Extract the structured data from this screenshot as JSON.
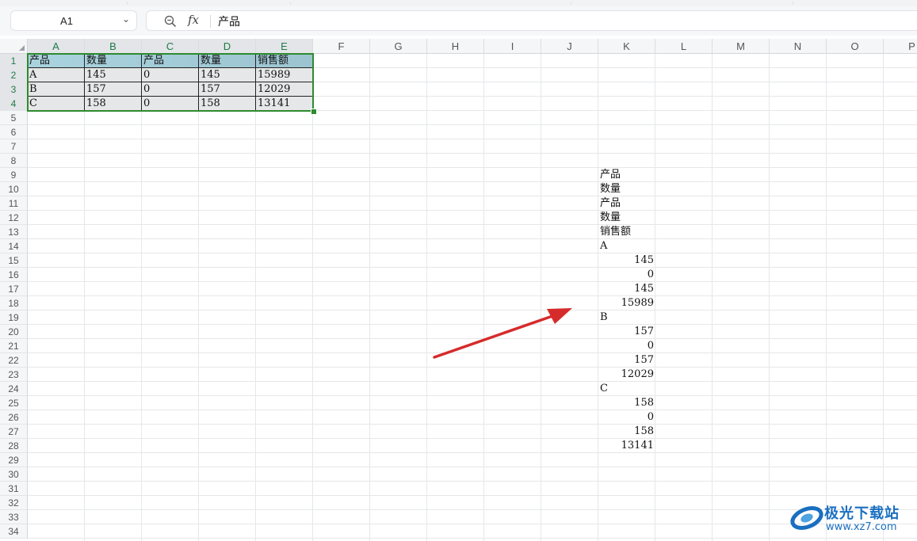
{
  "formula_bar": {
    "name_box": "A1",
    "fx_label": "fx",
    "formula": "产品"
  },
  "columns": [
    "A",
    "B",
    "C",
    "D",
    "E",
    "F",
    "G",
    "H",
    "I",
    "J",
    "K",
    "L",
    "M",
    "N",
    "O",
    "P"
  ],
  "rows": [
    "1",
    "2",
    "3",
    "4",
    "5",
    "6",
    "7",
    "8",
    "9",
    "10",
    "11",
    "12",
    "13",
    "14",
    "15",
    "16",
    "17",
    "18",
    "19",
    "20",
    "21",
    "22",
    "23",
    "24",
    "25",
    "26",
    "27",
    "28",
    "29",
    "30",
    "31",
    "32",
    "33",
    "34"
  ],
  "table": {
    "header": [
      "产品",
      "数量",
      "产品",
      "数量",
      "销售额"
    ],
    "rows": [
      [
        "A",
        "145",
        "0",
        "145",
        "15989"
      ],
      [
        "B",
        "157",
        "0",
        "157",
        "12029"
      ],
      [
        "C",
        "158",
        "0",
        "158",
        "13141"
      ]
    ]
  },
  "column_k": {
    "start_row": "9",
    "end_row": "28",
    "text_cells": [
      {
        "row": "9",
        "value": "产品"
      },
      {
        "row": "10",
        "value": "数量"
      },
      {
        "row": "11",
        "value": "产品"
      },
      {
        "row": "12",
        "value": "数量"
      },
      {
        "row": "13",
        "value": "销售额"
      },
      {
        "row": "14",
        "value": "A"
      },
      {
        "row": "19",
        "value": "B"
      },
      {
        "row": "24",
        "value": "C"
      }
    ],
    "number_cells": [
      {
        "row": "15",
        "value": "145"
      },
      {
        "row": "16",
        "value": "0"
      },
      {
        "row": "17",
        "value": "145"
      },
      {
        "row": "18",
        "value": "15989"
      },
      {
        "row": "20",
        "value": "157"
      },
      {
        "row": "21",
        "value": "0"
      },
      {
        "row": "22",
        "value": "157"
      },
      {
        "row": "23",
        "value": "12029"
      },
      {
        "row": "25",
        "value": "158"
      },
      {
        "row": "26",
        "value": "0"
      },
      {
        "row": "27",
        "value": "158"
      },
      {
        "row": "28",
        "value": "13141"
      }
    ]
  },
  "annotation": {
    "type": "red-arrow",
    "color": "#d62b2b"
  },
  "watermark": {
    "text": "极光下载站",
    "url": "www.xz7.com",
    "color": "#1a6fc1"
  }
}
